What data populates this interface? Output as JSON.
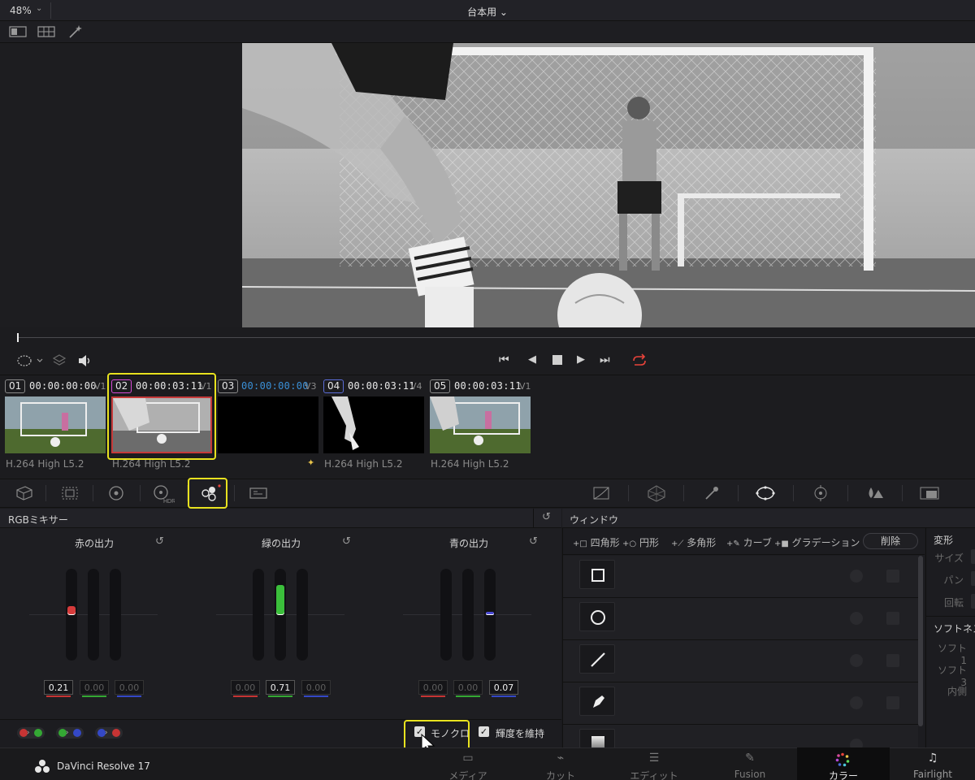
{
  "topbar": {
    "zoom": "48%",
    "timeline_name": "台本用 ⌄"
  },
  "clips": [
    {
      "num": "01",
      "tc": "00:00:00:00",
      "track": "V1",
      "codec": "H.264 High L5.2"
    },
    {
      "num": "02",
      "tc": "00:00:03:11",
      "track": "V1",
      "codec": "H.264 High L5.2"
    },
    {
      "num": "03",
      "tc": "00:00:00:00",
      "track": "V3",
      "codec": ""
    },
    {
      "num": "04",
      "tc": "00:00:03:11",
      "track": "V4",
      "codec": "H.264 High L5.2"
    },
    {
      "num": "05",
      "tc": "00:00:03:11",
      "track": "V1",
      "codec": "H.264 High L5.2"
    }
  ],
  "mixer": {
    "title": "RGBミキサー",
    "channels": [
      {
        "title": "赤の出力",
        "values": [
          "0.21",
          "0.00",
          "0.00"
        ],
        "levels": [
          0.21,
          0.0,
          0.0
        ]
      },
      {
        "title": "緑の出力",
        "values": [
          "0.00",
          "0.71",
          "0.00"
        ],
        "levels": [
          0.0,
          0.71,
          0.0
        ]
      },
      {
        "title": "青の出力",
        "values": [
          "0.00",
          "0.00",
          "0.07"
        ],
        "levels": [
          0.0,
          0.0,
          0.07
        ]
      }
    ],
    "monochrome_label": "モノクロ",
    "monochrome_checked": true,
    "preserve_luma_label": "輝度を維持",
    "preserve_luma_checked": true
  },
  "window_panel": {
    "title": "ウィンドウ",
    "tools": [
      "四角形",
      "円形",
      "多角形",
      "カーブ",
      "グラデーション"
    ],
    "delete_label": "削除"
  },
  "transform": {
    "title": "変形",
    "size": "サイズ",
    "pan": "パン",
    "rotate": "回転",
    "softness": "ソフトネス",
    "soft1": "ソフト1",
    "soft3": "ソフト3",
    "inner": "内側"
  },
  "pagebar": {
    "app_name": "DaVinci Resolve 17",
    "pages": [
      {
        "label": "メディア",
        "icon": "media-page-icon"
      },
      {
        "label": "カット",
        "icon": "cut-page-icon"
      },
      {
        "label": "エディット",
        "icon": "edit-page-icon"
      },
      {
        "label": "Fusion",
        "icon": "fusion-page-icon"
      },
      {
        "label": "カラー",
        "icon": "color-page-icon"
      },
      {
        "label": "Fairlight",
        "icon": "fairlight-page-icon"
      }
    ],
    "active_page": "カラー"
  }
}
